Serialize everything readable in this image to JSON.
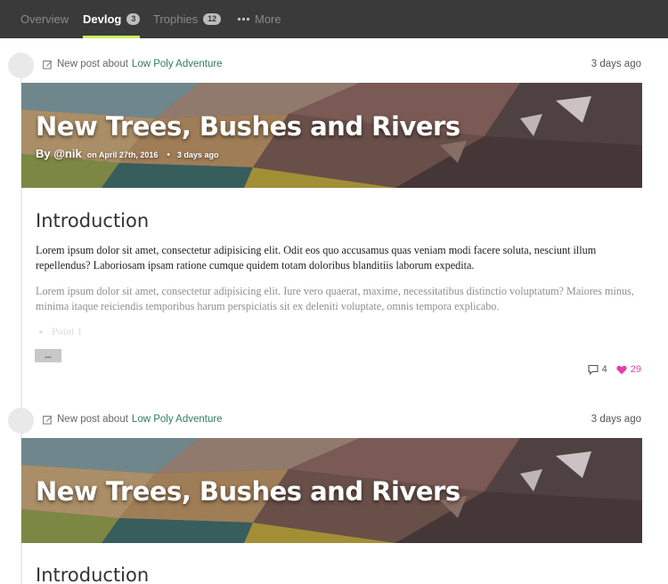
{
  "nav": {
    "tabs": [
      {
        "label": "Overview",
        "active": false
      },
      {
        "label": "Devlog",
        "badge": "3",
        "active": true
      },
      {
        "label": "Trophies",
        "badge": "12",
        "active": false
      },
      {
        "label": "More",
        "icon": "dots-icon",
        "active": false
      }
    ]
  },
  "colors": {
    "nav_bg": "#3a3a3a",
    "active_underline": "#c6f25e",
    "game_link": "#2e7d5b",
    "like": "#e23fa8"
  },
  "posts": [
    {
      "meta_prefix": "New post about",
      "game": "Low Poly Adventure",
      "time": "3 days ago",
      "title": "New Trees, Bushes and Rivers",
      "author": "By @nik",
      "date": "on April 27th, 2016",
      "separator": "•",
      "ago": "3 days ago",
      "heading": "Introduction",
      "paragraph1": "Lorem ipsum dolor sit amet, consectetur adipisicing elit. Odit eos quo accusamus quas veniam modi facere soluta, nesciunt illum repellendus? Laboriosam ipsam ratione cumque quidem totam doloribus blanditiis laborum expedita.",
      "paragraph2": "Lorem ipsum dolor sit amet, consectetur adipisicing elit. Iure vero quaerat, maxime, necessitatibus distinctio voluptatum? Maiores minus, minima itaque reiciendis temporibus harum perspiciatis sit ex deleniti voluptate, omnis tempora explicabo.",
      "bullet": "Point 1",
      "more_label": "...",
      "comments": "4",
      "likes": "29"
    },
    {
      "meta_prefix": "New post about",
      "game": "Low Poly Adventure",
      "time": "3 days ago",
      "title": "New Trees, Bushes and Rivers",
      "heading": "Introduction"
    }
  ]
}
